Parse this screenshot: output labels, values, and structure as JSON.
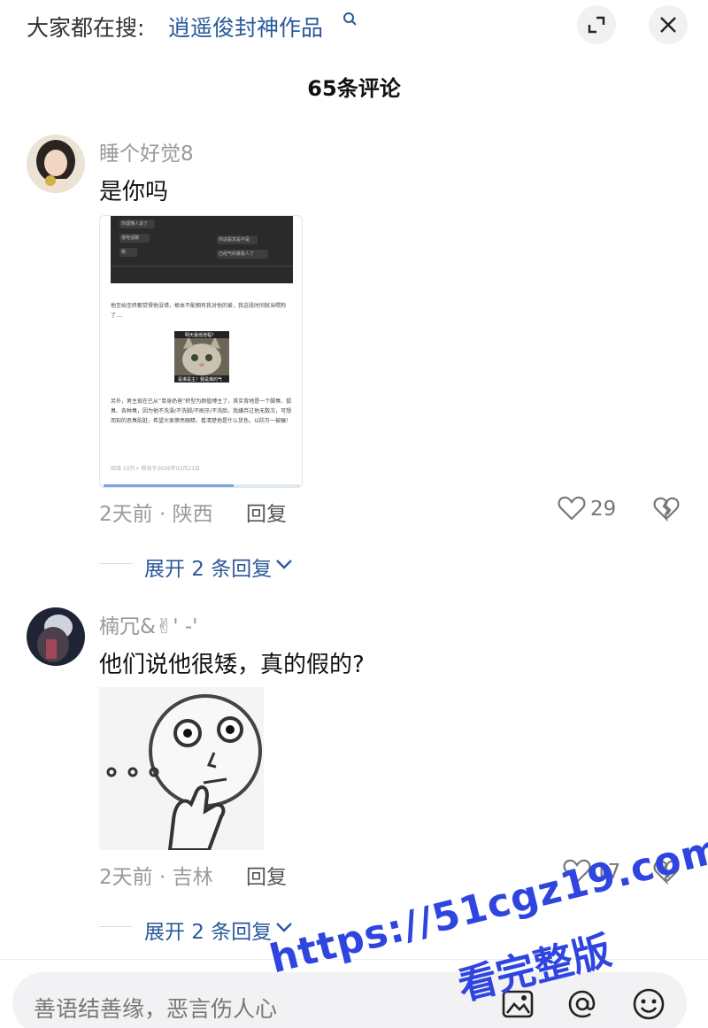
{
  "search": {
    "prefix": "大家都在搜:",
    "term": "逍遥俊封神作品"
  },
  "comments_header": {
    "count_label": "65条评论"
  },
  "comments": [
    {
      "username": "睡个好觉8",
      "text": "是你吗",
      "time_location": "2天前 · 陕西",
      "reply_label": "回复",
      "likes": "29",
      "expand_label": "展开 2 条回复",
      "image": {
        "chat_lines": [
          "你理懂人说了",
          "很电话聊",
          "嗯",
          "你这般发是不是",
          "已经气的暴看人了"
        ],
        "paragraph_1": "他至始至终都觉得他没错，根本不配拥有我对他的爱，我这段时间就当喂狗了....",
        "meme_caption": "明天最低增程？",
        "meme_caption_2": "是谁是主！我是谁的气足？",
        "paragraph_2": "另外，男主现在已从“单身奶爸”转型为颜值博主了，其实背地是一个脚臭、狐臭、各种臭，因为他不洗澡/不洗脚/不刷牙/不洗脸，我嫌弃过他无数次，可想而知的恶臭肮脏，希望大家擦亮眼睛，看清楚他是什么货色，以防万一被骗！",
        "footer": "阅读 10万+   修改于2026年02月21日",
        "progress": 0.66
      }
    },
    {
      "username": "楠冗&✌' -'",
      "text": "他们说他很矮，真的假的?",
      "time_location": "2天前 · 吉林",
      "reply_label": "回复",
      "likes": "17",
      "expand_label": "展开 2 条回复"
    }
  ],
  "input": {
    "placeholder": "善语结善缘，恶言伤人心"
  },
  "watermark": {
    "line1": "https://51cgz19.com",
    "line2": "看完整版"
  },
  "icons": {
    "expand": "expand-icon",
    "close": "close-icon",
    "like": "heart-icon",
    "dislike": "broken-heart-icon",
    "image": "image-icon",
    "mention": "at-icon",
    "emoji": "emoji-icon"
  },
  "colors": {
    "link": "#2a5a9a",
    "watermark": "#2f45e0"
  }
}
